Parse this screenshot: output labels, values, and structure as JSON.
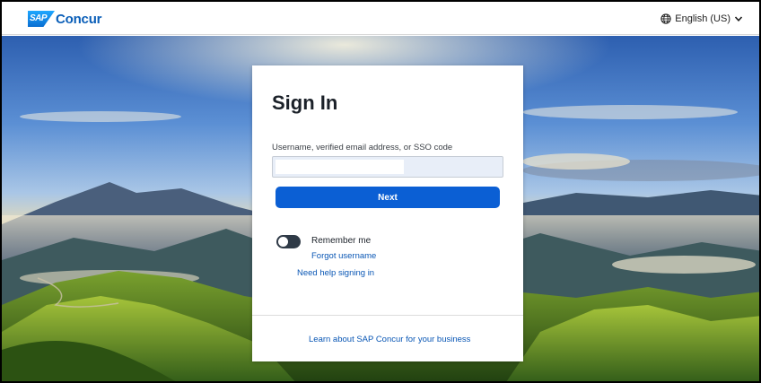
{
  "header": {
    "logo_mark": "SAP",
    "brand": "Concur",
    "language": "English (US)",
    "globe_icon": "globe-icon",
    "chevron_icon": "chevron-down-icon"
  },
  "signin": {
    "title": "Sign In",
    "username_label": "Username, verified email address, or SSO code",
    "username_value": "",
    "next_label": "Next",
    "remember_label": "Remember me",
    "remember_on": false,
    "forgot_label": "Forgot username",
    "help_label": "Need help signing in",
    "learn_label": "Learn about SAP Concur for your business"
  },
  "colors": {
    "primary": "#0b5fd4",
    "link": "#0a57b5",
    "toggle_off": "#2f3a47",
    "brand_blue": "#0a5eb8"
  }
}
